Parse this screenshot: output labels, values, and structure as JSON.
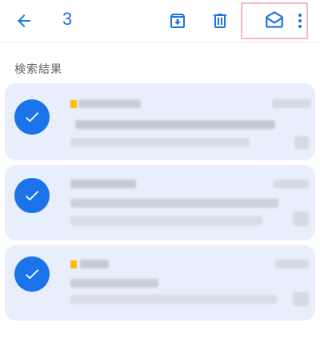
{
  "toolbar": {
    "back_icon": "arrow-left-icon",
    "selected_count": "3",
    "archive_icon": "archive-icon",
    "delete_icon": "trash-icon",
    "mark_read_icon": "envelope-open-icon",
    "more_icon": "more-vertical-icon"
  },
  "section": {
    "label": "検索結果"
  },
  "colors": {
    "accent": "#1a73e8",
    "card_bg": "#e8eefb",
    "highlight": "#f3b6d4",
    "important": "#fbbc04"
  },
  "emails": [
    {
      "selected": true,
      "important": true
    },
    {
      "selected": true,
      "important": false
    },
    {
      "selected": true,
      "important": true
    }
  ]
}
